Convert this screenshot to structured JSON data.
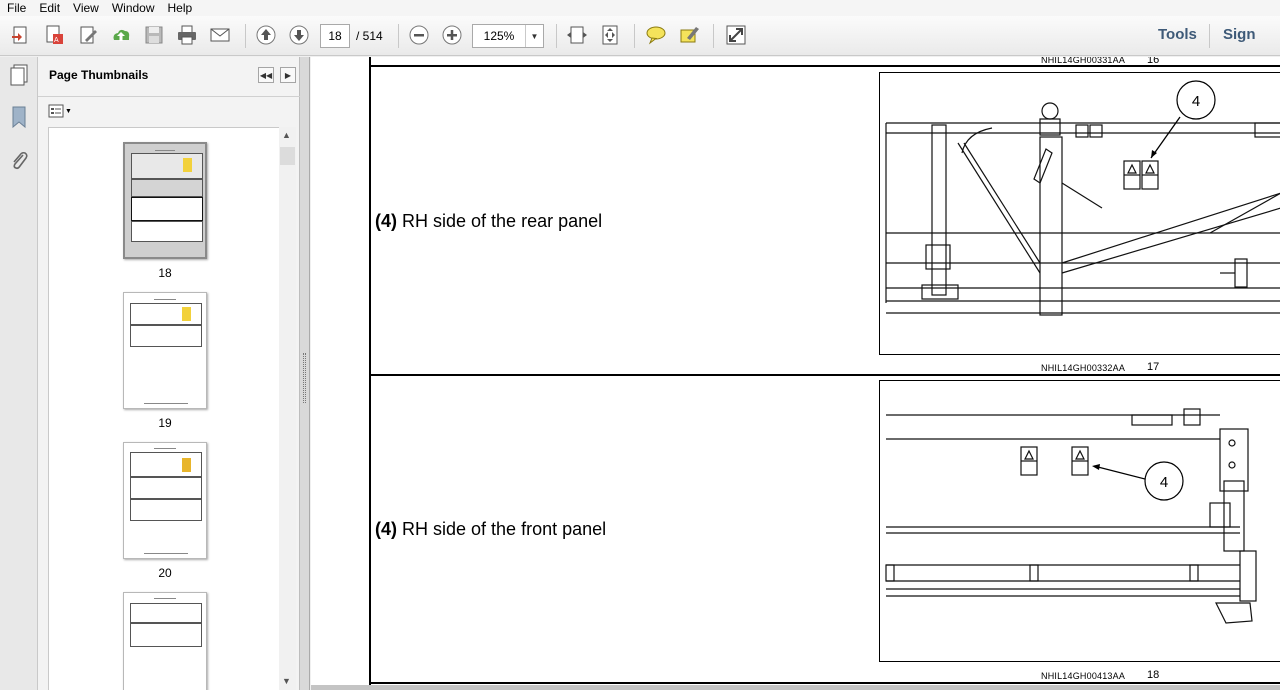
{
  "menu": [
    "File",
    "Edit",
    "View",
    "Window",
    "Help"
  ],
  "toolbar": {
    "page_current": "18",
    "page_total": "/ 514",
    "zoom": "125%",
    "tools_label": "Tools",
    "sign_label": "Sign"
  },
  "thumbnails": {
    "title": "Page Thumbnails",
    "pages": [
      "18",
      "19",
      "20"
    ]
  },
  "document": {
    "rows": [
      {
        "caption": "NHIL14GH00331AA",
        "number": "16"
      },
      {
        "number_bold": "(4)",
        "text": "RH side of the rear panel",
        "caption": "NHIL14GH00332AA",
        "number": "17",
        "callout": "4"
      },
      {
        "number_bold": "(4)",
        "text": "RH side of the front panel",
        "caption": "NHIL14GH00413AA",
        "number": "18",
        "callout": "4"
      }
    ]
  },
  "colors": {
    "accent_link": "#3e5a78",
    "sticker_yellow": "#f2d13b",
    "doc_background": "#7b7b7b"
  },
  "icons": [
    "create-pdf-icon",
    "edit-pdf-icon",
    "sign-icon",
    "upload-icon",
    "save-icon",
    "print-icon",
    "email-icon",
    "prev-page-icon",
    "next-page-icon",
    "zoom-out-icon",
    "zoom-in-icon",
    "fit-width-icon",
    "fit-page-icon",
    "comment-icon",
    "highlight-icon",
    "fullscreen-icon"
  ]
}
